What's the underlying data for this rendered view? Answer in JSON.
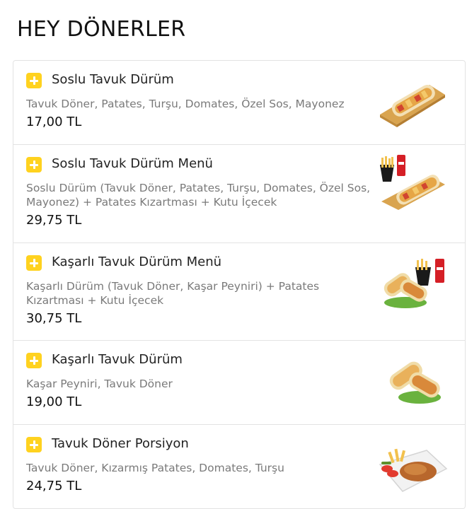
{
  "section": {
    "title": "HEY DÖNERLER"
  },
  "items": [
    {
      "name": "Soslu Tavuk Dürüm",
      "description": "Tavuk Döner, Patates, Turşu, Domates, Özel Sos, Mayonez",
      "price": "17,00 TL",
      "image_icon": "wrap-on-board-icon"
    },
    {
      "name": "Soslu Tavuk Dürüm Menü",
      "description": "Soslu Dürüm (Tavuk Döner, Patates, Turşu, Domates, Özel Sos, Mayonez) + Patates Kızartması + Kutu İçecek",
      "price": "29,75 TL",
      "image_icon": "wrap-menu-with-fries-and-cola-icon"
    },
    {
      "name": "Kaşarlı Tavuk Dürüm Menü",
      "description": "Kaşarlı Dürüm (Tavuk Döner, Kaşar Peyniri) + Patates Kızartması + Kutu İçecek",
      "price": "30,75 TL",
      "image_icon": "cheese-wrap-menu-icon"
    },
    {
      "name": "Kaşarlı Tavuk Dürüm",
      "description": "Kaşar Peyniri, Tavuk Döner",
      "price": "19,00 TL",
      "image_icon": "cheese-wrap-icon"
    },
    {
      "name": "Tavuk Döner Porsiyon",
      "description": "Tavuk Döner, Kızarmış Patates, Domates, Turşu",
      "price": "24,75 TL",
      "image_icon": "doner-plate-icon"
    }
  ],
  "colors": {
    "accent": "#ffd21f",
    "text": "#222222",
    "muted": "#7a7a7a",
    "border": "#e3e3e3"
  }
}
